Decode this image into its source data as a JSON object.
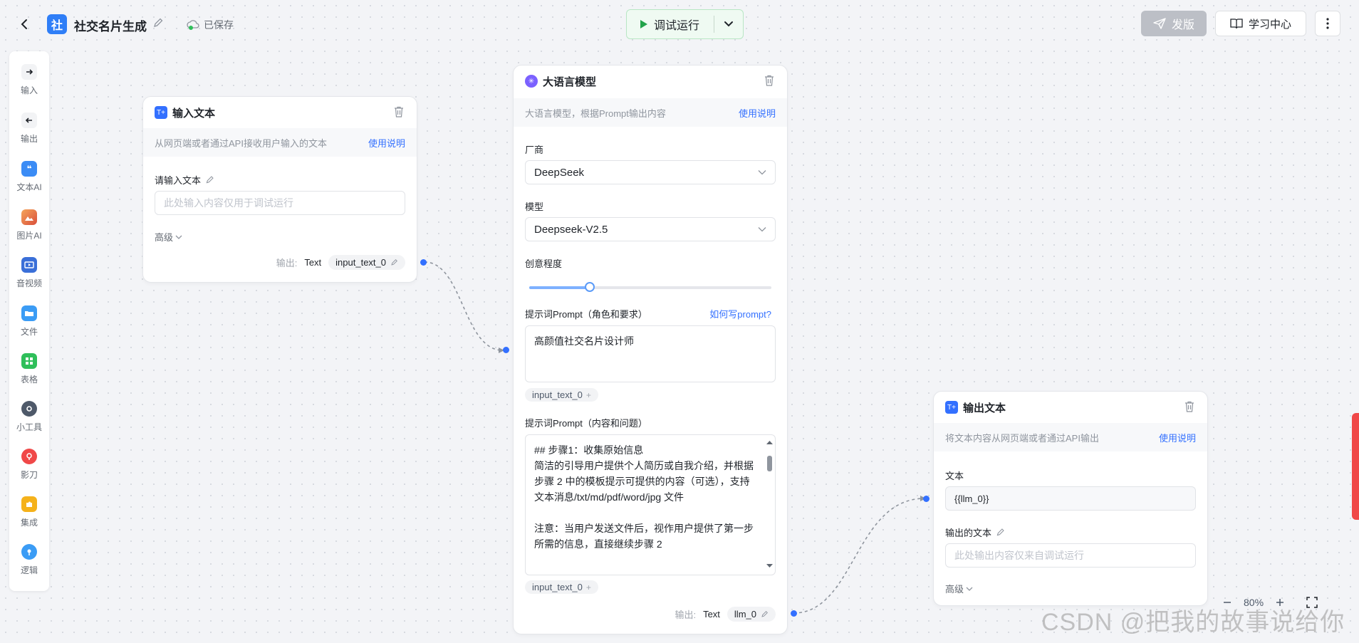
{
  "header": {
    "app_logo_text": "社",
    "title": "社交名片生成",
    "save_status": "已保存",
    "run_label": "调试运行",
    "publish_label": "发版",
    "learn_label": "学习中心"
  },
  "toolbar": {
    "items": [
      {
        "label": "输入",
        "icon": "arrow-right-icon",
        "color": "#4e5969"
      },
      {
        "label": "输出",
        "icon": "arrow-left-icon",
        "color": "#4e5969"
      },
      {
        "label": "文本AI",
        "icon": "quote-icon",
        "color": "#3b8cf5"
      },
      {
        "label": "图片AI",
        "icon": "image-icon",
        "color": "#e8724a"
      },
      {
        "label": "音视频",
        "icon": "video-icon",
        "color": "#3a6fd8"
      },
      {
        "label": "文件",
        "icon": "folder-icon",
        "color": "#3b9cf5"
      },
      {
        "label": "表格",
        "icon": "table-icon",
        "color": "#2fbf5a"
      },
      {
        "label": "小工具",
        "icon": "gear-icon",
        "color": "#4e5969"
      },
      {
        "label": "影刀",
        "icon": "shadow-knife-icon",
        "color": "#f04848"
      },
      {
        "label": "集成",
        "icon": "puzzle-icon",
        "color": "#f5b21b"
      },
      {
        "label": "逻辑",
        "icon": "logic-pin-icon",
        "color": "#3b9cf5"
      }
    ]
  },
  "input_node": {
    "title": "输入文本",
    "icon_text": "T+",
    "desc": "从网页端或者通过API接收用户输入的文本",
    "help": "使用说明",
    "field_label": "请输入文本",
    "placeholder": "此处输入内容仅用于调试运行",
    "advanced": "高级",
    "output_label": "输出:",
    "output_type": "Text",
    "output_var": "input_text_0"
  },
  "llm_node": {
    "title": "大语言模型",
    "desc": "大语言模型，根据Prompt输出内容",
    "help": "使用说明",
    "vendor_label": "厂商",
    "vendor_value": "DeepSeek",
    "model_label": "模型",
    "model_value": "Deepseek-V2.5",
    "creativity_label": "创意程度",
    "creativity_value": 0.25,
    "system_prompt_label": "提示词Prompt（角色和要求）",
    "how_to_prompt": "如何写prompt?",
    "system_prompt_value": "高颜值社交名片设计师",
    "system_tag": "input_text_0",
    "user_prompt_label": "提示词Prompt（内容和问题）",
    "user_prompt_value": "## 步骤1：收集原始信息\n简洁的引导用户提供个人简历或自我介绍，并根据步骤 2 中的模板提示可提供的内容（可选），支持 文本消息/txt/md/pdf/word/jpg 文件\n\n注意：当用户发送文件后，视作用户提供了第一步所需的信息，直接继续步骤 2",
    "user_tag": "input_text_0",
    "output_label": "输出:",
    "output_type": "Text",
    "output_var": "llm_0"
  },
  "output_node": {
    "title": "输出文本",
    "icon_text": "T+",
    "desc": "将文本内容从网页端或者通过API输出",
    "help": "使用说明",
    "text_label": "文本",
    "text_value": "{{llm_0}}",
    "out_label": "输出的文本",
    "out_placeholder": "此处输出内容仅来自调试运行",
    "advanced": "高级"
  },
  "zoom": {
    "level": "80%"
  },
  "watermark": "CSDN @把我的故事说给你"
}
